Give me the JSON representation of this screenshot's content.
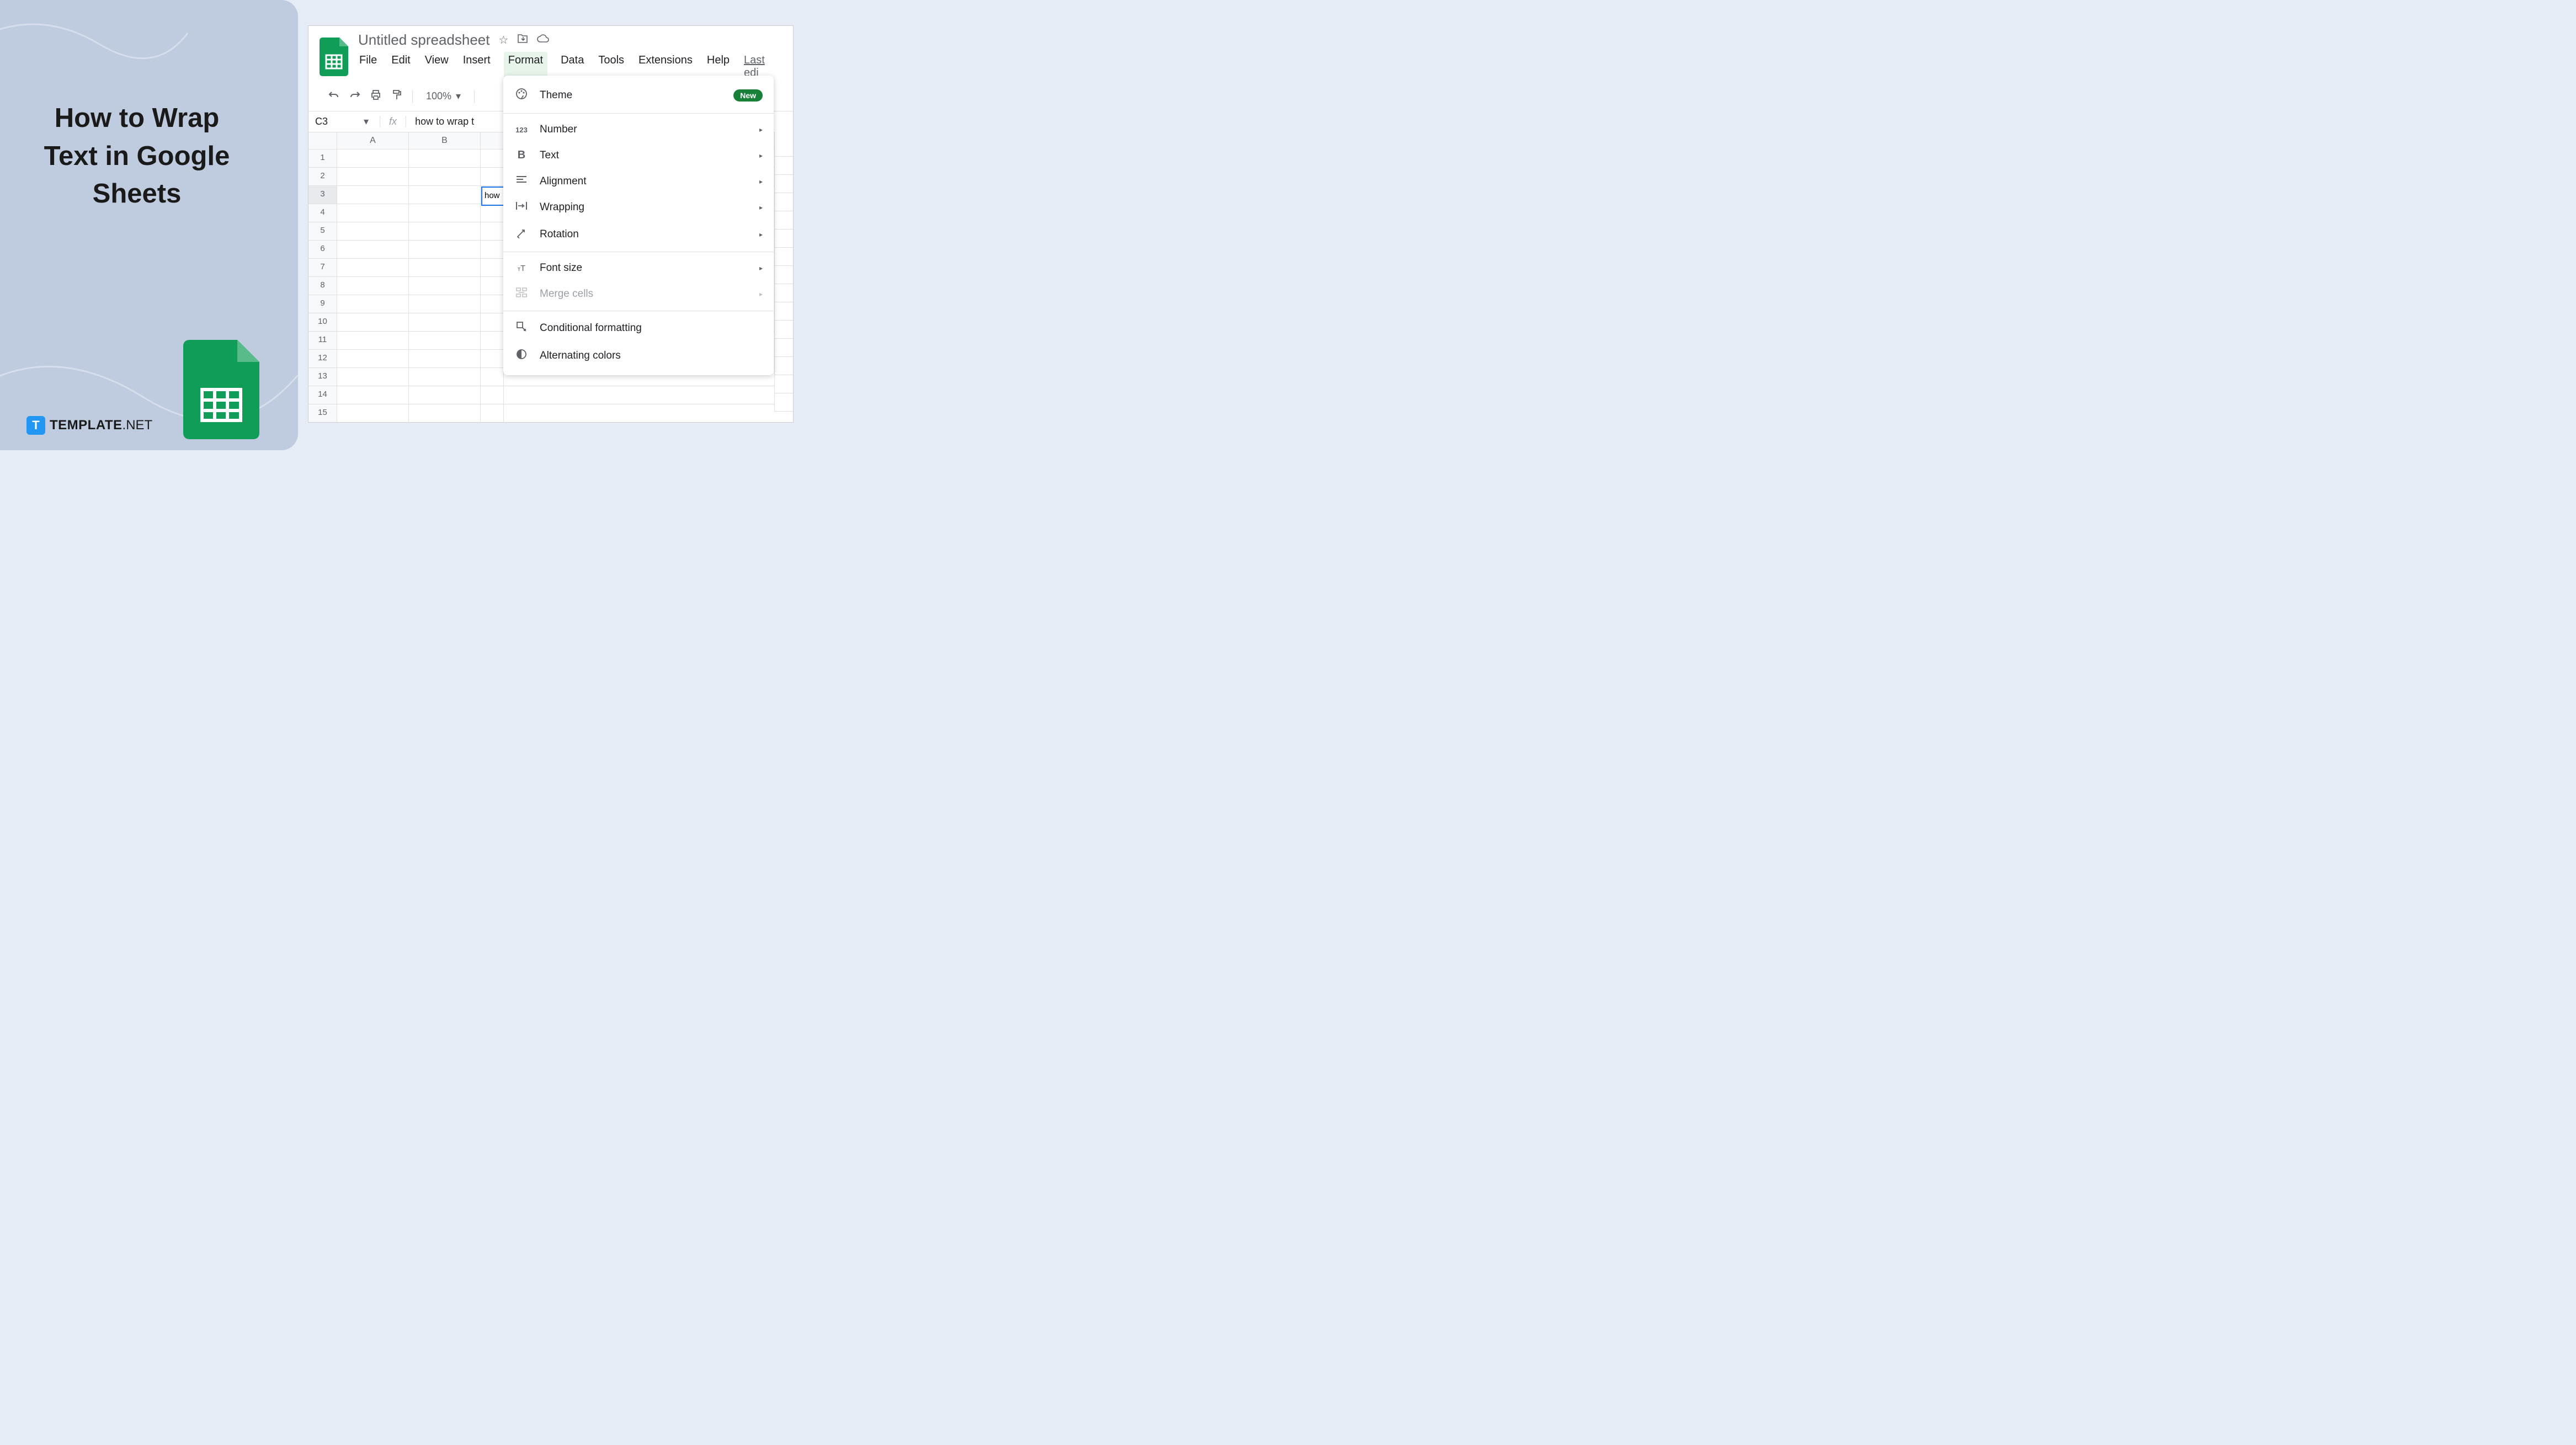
{
  "title": "How to Wrap Text in Google Sheets",
  "branding": {
    "template": "TEMPLATE",
    "net": ".NET",
    "icon_letter": "T"
  },
  "doc": {
    "name": "Untitled spreadsheet",
    "last_edit": "Last edi"
  },
  "menubar": [
    "File",
    "Edit",
    "View",
    "Insert",
    "Format",
    "Data",
    "Tools",
    "Extensions",
    "Help"
  ],
  "active_menu": "Format",
  "toolbar": {
    "zoom": "100%"
  },
  "formula": {
    "cell": "C3",
    "fx": "fx",
    "value": "how to wrap t"
  },
  "columns": [
    "A",
    "B"
  ],
  "rows": [
    "1",
    "2",
    "3",
    "4",
    "5",
    "6",
    "7",
    "8",
    "9",
    "10",
    "11",
    "12",
    "13",
    "14",
    "15"
  ],
  "active_row": "3",
  "active_cell_text": "how",
  "format_menu": [
    {
      "icon": "🎨",
      "label": "Theme",
      "badge": "New",
      "submenu": false
    },
    {
      "divider": true
    },
    {
      "icon": "123",
      "label": "Number",
      "submenu": true
    },
    {
      "icon": "B",
      "label": "Text",
      "submenu": true
    },
    {
      "icon": "≡",
      "label": "Alignment",
      "submenu": true
    },
    {
      "icon": "↹",
      "label": "Wrapping",
      "submenu": true
    },
    {
      "icon": "⟳",
      "label": "Rotation",
      "submenu": true
    },
    {
      "divider": true
    },
    {
      "icon": "тT",
      "label": "Font size",
      "submenu": true
    },
    {
      "icon": "⛶",
      "label": "Merge cells",
      "submenu": true,
      "disabled": true
    },
    {
      "divider": true
    },
    {
      "icon": "🖌",
      "label": "Conditional formatting",
      "submenu": false
    },
    {
      "icon": "◐",
      "label": "Alternating colors",
      "submenu": false
    }
  ]
}
